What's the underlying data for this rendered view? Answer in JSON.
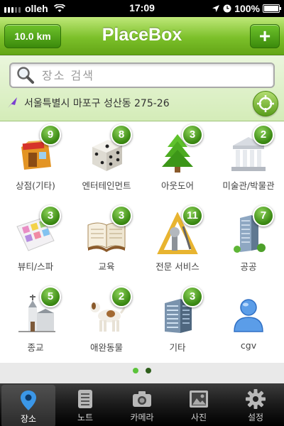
{
  "status_bar": {
    "carrier": "olleh",
    "time": "17:09",
    "battery": "100%"
  },
  "header": {
    "distance_button": "10.0 km",
    "title": "PlaceBox",
    "add_button": "+"
  },
  "search": {
    "placeholder": "장소 검색"
  },
  "location": {
    "address": "서울특별시 마포구 성산동 275-26"
  },
  "categories": [
    {
      "label": "상점(기타)",
      "count": "9",
      "icon": "shop-icon"
    },
    {
      "label": "엔터테인먼트",
      "count": "8",
      "icon": "dice-icon"
    },
    {
      "label": "아웃도어",
      "count": "3",
      "icon": "tree-icon"
    },
    {
      "label": "미술관/박물관",
      "count": "2",
      "icon": "museum-icon"
    },
    {
      "label": "뷰티/스파",
      "count": "3",
      "icon": "palette-icon"
    },
    {
      "label": "교육",
      "count": "3",
      "icon": "book-icon"
    },
    {
      "label": "전문 서비스",
      "count": "11",
      "icon": "tools-icon"
    },
    {
      "label": "공공",
      "count": "7",
      "icon": "public-building-icon"
    },
    {
      "label": "종교",
      "count": "5",
      "icon": "church-icon"
    },
    {
      "label": "애완동물",
      "count": "2",
      "icon": "dog-icon"
    },
    {
      "label": "기타",
      "count": "3",
      "icon": "office-building-icon"
    },
    {
      "label": "cgv",
      "count": "",
      "icon": "person-icon"
    }
  ],
  "pagination": {
    "pages": 2,
    "current": 1
  },
  "tabs": [
    {
      "label": "장소",
      "icon": "map-pin-icon",
      "active": true
    },
    {
      "label": "노트",
      "icon": "notes-icon",
      "active": false
    },
    {
      "label": "카메라",
      "icon": "camera-icon",
      "active": false
    },
    {
      "label": "사진",
      "icon": "photo-icon",
      "active": false
    },
    {
      "label": "설정",
      "icon": "gear-icon",
      "active": false
    }
  ],
  "colors": {
    "header_green": "#7cc02a",
    "badge_green": "#3c8b14",
    "tab_bar": "#1a1a1a"
  }
}
